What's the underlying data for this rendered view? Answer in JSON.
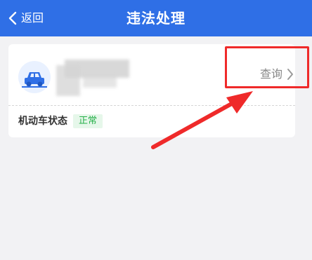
{
  "header": {
    "back_label": "返回",
    "title": "违法处理"
  },
  "vehicle_card": {
    "icon": "car-icon",
    "query_label": "查询",
    "status_label": "机动车状态",
    "status_value": "正常"
  },
  "colors": {
    "header_bg": "#2f6fe6",
    "page_bg": "#f2f2f4",
    "annotation": "#ef2a2a",
    "status_green": "#27b04a"
  }
}
